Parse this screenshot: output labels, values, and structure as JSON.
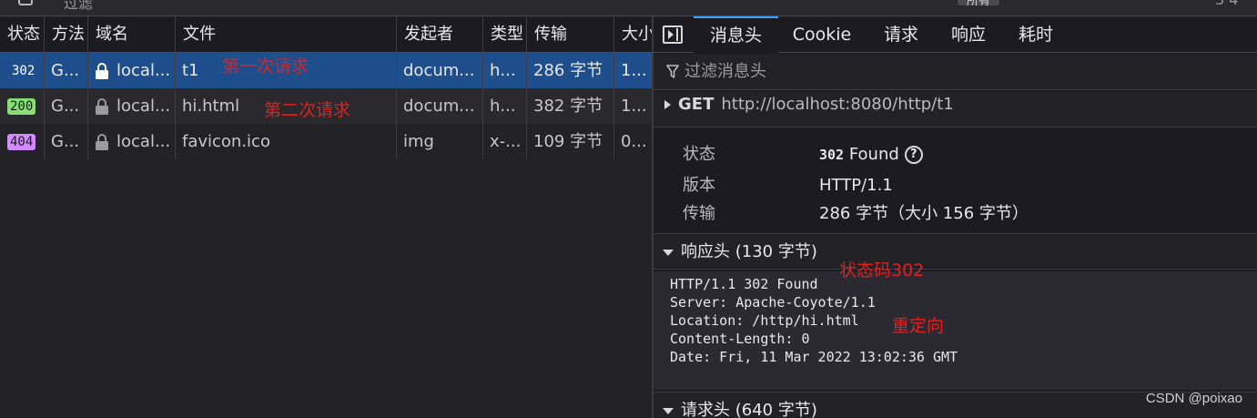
{
  "toolbar": {
    "filter_cut_text": "过滤",
    "pill_cut_text": "所有",
    "right_cut_text": "3 4"
  },
  "network": {
    "columns": [
      "状态",
      "方法",
      "域名",
      "文件",
      "发起者",
      "类型",
      "传输",
      "大小"
    ],
    "rows": [
      {
        "status": "302",
        "method": "G...",
        "domain": "local...",
        "file": "t1",
        "initiator": "docum...",
        "type": "h...",
        "transferred": "286 字节",
        "size": "1..."
      },
      {
        "status": "200",
        "method": "G...",
        "domain": "local...",
        "file": "hi.html",
        "initiator": "docum...",
        "type": "h...",
        "transferred": "382 字节",
        "size": "1..."
      },
      {
        "status": "404",
        "method": "G...",
        "domain": "local...",
        "file": "favicon.ico",
        "initiator": "img",
        "type": "x-...",
        "transferred": "109 字节",
        "size": "0..."
      }
    ],
    "annotations": {
      "first": "第一次请求",
      "second": "第二次请求"
    }
  },
  "detail": {
    "tabs": [
      "消息头",
      "Cookie",
      "请求",
      "响应",
      "耗时"
    ],
    "active_tab": "消息头",
    "filter_placeholder": "过滤消息头",
    "request": {
      "method": "GET",
      "url": "http://localhost:8080/http/t1"
    },
    "summary": {
      "status_label": "状态",
      "status_code": "302",
      "status_text": "Found",
      "version_label": "版本",
      "version": "HTTP/1.1",
      "transfer_label": "传输",
      "transfer": "286 字节（大小 156 字节）"
    },
    "response_headers_title": "响应头 (130 字节)",
    "response_raw": [
      "HTTP/1.1 302 Found",
      "Server: Apache-Coyote/1.1",
      "Location: /http/hi.html",
      "Content-Length: 0",
      "Date: Fri, 11 Mar 2022 13:02:36 GMT"
    ],
    "request_headers_title": "请求头 (640 字节)",
    "annotations": {
      "status_code": "状态码302",
      "redirect": "重定向"
    }
  },
  "watermark": "CSDN @poixao",
  "colors": {
    "selected_row": "#1f4e8d",
    "status_200": "#86de74",
    "status_404": "#d28bfd",
    "annotation": "#e3201b",
    "active_tab_accent": "#3aa3ff"
  }
}
